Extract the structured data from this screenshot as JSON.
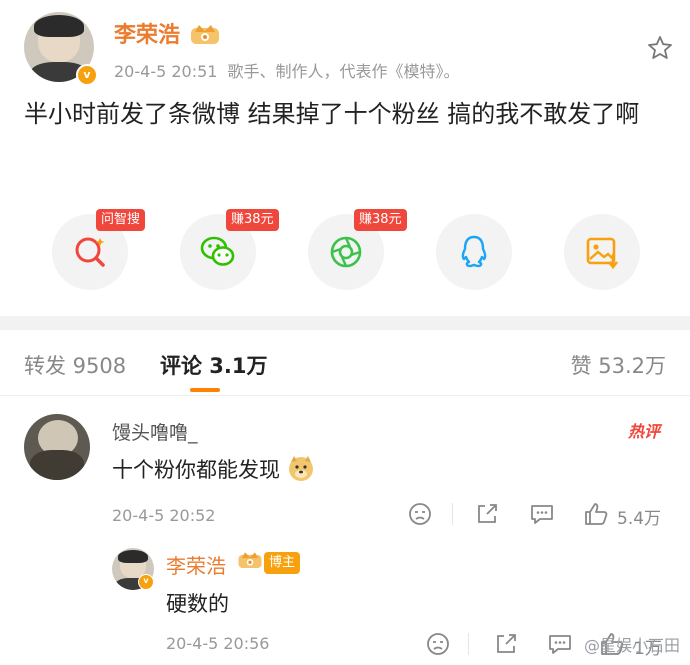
{
  "post": {
    "author": "李荣浩",
    "time": "20-4-5 20:51",
    "bio": "歌手、制作人，代表作《模特》。",
    "verified_mark": "v",
    "text": "半小时前发了条微博 结果掉了十个粉丝 搞的我不敢发了啊",
    "icons": {
      "crown": "crown-badge-icon",
      "star": "star-outline-icon"
    }
  },
  "share": {
    "items": [
      {
        "icon": "search-question-icon",
        "tag": "问智搜",
        "color": "#f0473d"
      },
      {
        "icon": "wechat-icon",
        "tag": "赚38元",
        "color": "#2dc100"
      },
      {
        "icon": "moments-icon",
        "tag": "赚38元",
        "color": "#3cc24a"
      },
      {
        "icon": "qq-icon",
        "tag": "",
        "color": "#1aa6f5"
      },
      {
        "icon": "save-image-icon",
        "tag": "",
        "color": "#f7a10f"
      }
    ]
  },
  "tabs": {
    "repost": "转发 9508",
    "comments": "评论 3.1万",
    "likes": "赞 53.2万",
    "accent": "#ff8200"
  },
  "comments": [
    {
      "name": "馒头噜噜_",
      "text": "十个粉你都能发现",
      "time": "20-4-5 20:52",
      "hot": "热评",
      "like_count": "5.4万"
    }
  ],
  "reply": {
    "name": "李荣浩",
    "tag": "博主",
    "text": "硬数的",
    "time": "20-4-5 20:56",
    "like_count": "1万"
  },
  "watermark": "@星娱小石田"
}
